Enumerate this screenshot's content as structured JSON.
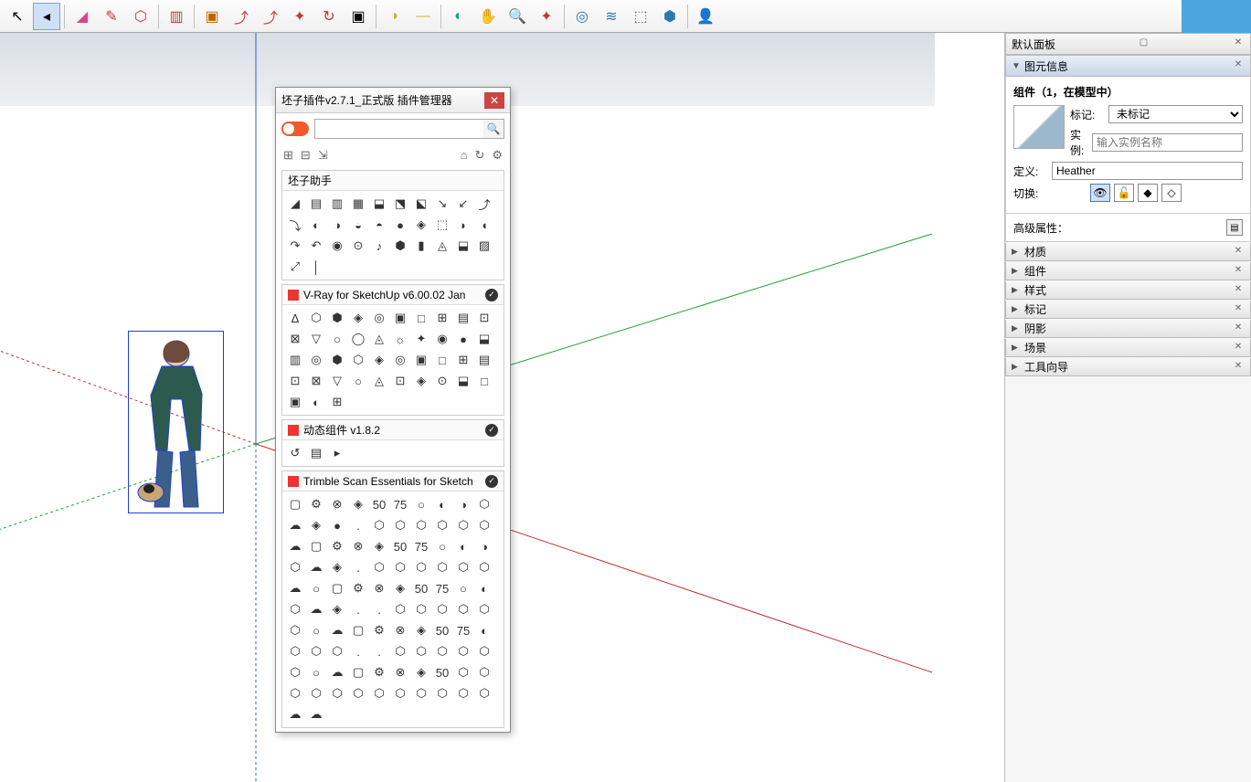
{
  "toolbar_icons": [
    "↖",
    "◂",
    "▯",
    "◢",
    "✎",
    "⬡",
    "⊕",
    "▥",
    "▣",
    "↺",
    "⤴",
    "✦",
    "↻",
    "▣",
    "⬚",
    "◑",
    "—",
    "◔",
    "◐",
    "↻",
    "⊙",
    "✋",
    "🔍",
    "✦",
    "◎",
    "≋",
    "⬚",
    "⬢",
    "👤"
  ],
  "dialog": {
    "title": "坯子插件v2.7.1_正式版 插件管理器",
    "search_placeholder": "",
    "action_icons_left": [
      "⊞",
      "⊟",
      "⇲"
    ],
    "action_icons_right": [
      "⌂",
      "↻",
      "⚙"
    ],
    "sections": [
      {
        "title": "坯子助手",
        "red": false,
        "icons": [
          "◢",
          "▤",
          "▥",
          "▦",
          "⬓",
          "⬔",
          "⬕",
          "↘",
          "↙",
          "⤴",
          "⤵",
          "◐",
          "◑",
          "◒",
          "◓",
          "●",
          "◈",
          "⬚",
          "◗",
          "◖",
          "↷",
          "↶",
          "◉",
          "⊙",
          "♪",
          "⬢",
          "▮",
          "◬",
          "⬓",
          "▨",
          "⤢",
          "│"
        ]
      },
      {
        "title": "V-Ray for SketchUp v6.00.02 Jan",
        "red": true,
        "icons": [
          "∆",
          "⬡",
          "⬢",
          "◈",
          "◎",
          "▣",
          "□",
          "⊞",
          "▤",
          "⊡",
          "⊠",
          "▽",
          "○",
          "◯",
          "◬",
          "☼",
          "✦",
          "◉",
          "●",
          "⬓",
          "▥",
          "◎",
          "⬢",
          "⬡",
          "◈",
          "◎",
          "▣",
          "□",
          "⊞",
          "▤",
          "⊡",
          "⊠",
          "▽",
          "○",
          "◬",
          "⊡",
          "◈",
          "⊙",
          "⬓",
          "□",
          "▣",
          "◐",
          "⊞"
        ]
      },
      {
        "title": "动态组件 v1.8.2",
        "red": true,
        "icons": [
          "↺",
          "▤",
          "▸"
        ]
      },
      {
        "title": "Trimble Scan Essentials for Sketch",
        "red": true,
        "icons": [
          "▢",
          "⚙",
          "⊗",
          "◈",
          "50",
          "75",
          "○",
          "◐",
          "◑",
          "⬡",
          "☁",
          "◈",
          "●",
          ".",
          "⬡",
          "⬡",
          "⬡",
          "⬡",
          "⬡",
          "⬡",
          "☁",
          "▢",
          "⚙",
          "⊗",
          "◈",
          "50",
          "75",
          "○",
          "◐",
          "◑",
          "⬡",
          "☁",
          "◈",
          ".",
          "⬡",
          "⬡",
          "⬡",
          "⬡",
          "⬡",
          "⬡",
          "☁",
          "○",
          "▢",
          "⚙",
          "⊗",
          "◈",
          "50",
          "75",
          "○",
          "◐",
          "⬡",
          "☁",
          "◈",
          ".",
          ".",
          "⬡",
          "⬡",
          "⬡",
          "⬡",
          "⬡",
          "⬡",
          "○",
          "☁",
          "▢",
          "⚙",
          "⊗",
          "◈",
          "50",
          "75",
          "◐",
          "⬡",
          "⬡",
          "⬡",
          ".",
          ".",
          "⬡",
          "⬡",
          "⬡",
          "⬡",
          "⬡",
          "⬡",
          "○",
          "☁",
          "▢",
          "⚙",
          "⊗",
          "◈",
          "50",
          "⬡",
          "⬡",
          "⬡",
          "⬡",
          "⬡",
          "⬡",
          "⬡",
          "⬡",
          "⬡",
          "⬡",
          "⬡",
          "⬡",
          "☁",
          "☁"
        ]
      }
    ]
  },
  "right": {
    "main_title": "默认面板",
    "entity_title": "图元信息",
    "entity_head": "组件（1，在模型中）",
    "labels": {
      "tag": "标记:",
      "instance": "实例:",
      "definition": "定义:",
      "toggle": "切换:"
    },
    "values": {
      "tag": "未标记",
      "instance_ph": "输入实例名称",
      "definition": "Heather"
    },
    "adv_prop": "高级属性：",
    "accordion": [
      "材质",
      "组件",
      "样式",
      "标记",
      "阴影",
      "场景",
      "工具向导"
    ]
  }
}
